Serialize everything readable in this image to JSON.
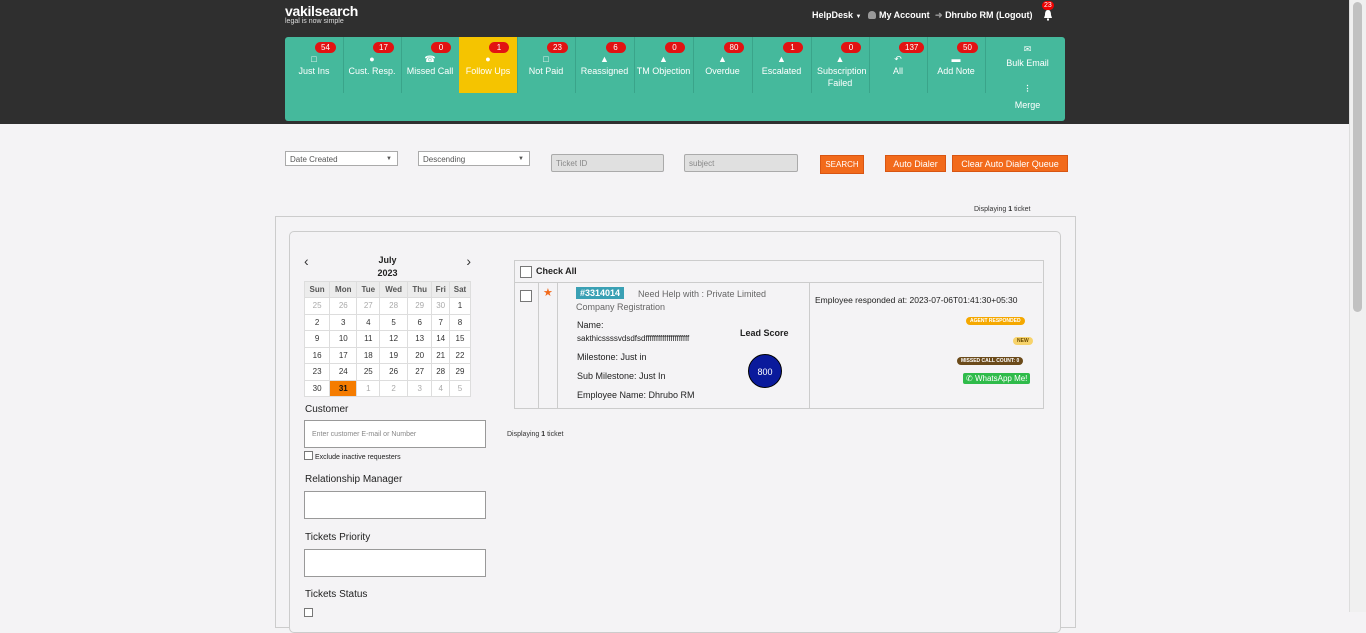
{
  "header": {
    "logo": "vakilsearch",
    "tagline": "legal is now simple",
    "helpdesk": "HelpDesk",
    "my_account": "My Account",
    "user": "Dhrubo RM (Logout)",
    "notif_count": "23"
  },
  "toolbar": {
    "items": [
      {
        "label": "Just Ins",
        "count": "54",
        "icon": "file-icon"
      },
      {
        "label": "Cust. Resp.",
        "count": "17",
        "icon": "user-icon"
      },
      {
        "label": "Missed Call",
        "count": "0",
        "icon": "phone-icon"
      },
      {
        "label": "Follow Ups",
        "count": "1",
        "icon": "user-icon",
        "active": true
      },
      {
        "label": "Not Paid",
        "count": "23",
        "icon": "file-icon"
      },
      {
        "label": "Reassigned",
        "count": "6",
        "icon": "bell-icon"
      },
      {
        "label": "TM Objection",
        "count": "0",
        "icon": "bell-icon"
      },
      {
        "label": "Overdue",
        "count": "80",
        "icon": "bell-icon"
      },
      {
        "label": "Escalated",
        "count": "1",
        "icon": "bell-icon"
      },
      {
        "label": "Subscription Failed",
        "count": "0",
        "icon": "bell-icon"
      },
      {
        "label": "All",
        "count": "137",
        "icon": "reply-icon"
      },
      {
        "label": "Add Note",
        "count": "50",
        "icon": "comment-icon"
      }
    ],
    "bulk_email": "Bulk Email",
    "merge": "Merge"
  },
  "filters": {
    "sort_field": "Date Created",
    "sort_order": "Descending",
    "ticket_id_placeholder": "Ticket ID",
    "subject_placeholder": "subject",
    "search": "SEARCH",
    "auto_dialer": "Auto Dialer",
    "clear_queue": "Clear Auto Dialer Queue"
  },
  "displaying_top": {
    "prefix": "Displaying ",
    "count": "1",
    "suffix": " ticket"
  },
  "calendar": {
    "month": "July",
    "year": "2023",
    "days": [
      "Sun",
      "Mon",
      "Tue",
      "Wed",
      "Thu",
      "Fri",
      "Sat"
    ],
    "weeks": [
      [
        "25",
        "26",
        "27",
        "28",
        "29",
        "30",
        "1"
      ],
      [
        "2",
        "3",
        "4",
        "5",
        "6",
        "7",
        "8"
      ],
      [
        "9",
        "10",
        "11",
        "12",
        "13",
        "14",
        "15"
      ],
      [
        "16",
        "17",
        "18",
        "19",
        "20",
        "21",
        "22"
      ],
      [
        "23",
        "24",
        "25",
        "26",
        "27",
        "28",
        "29"
      ],
      [
        "30",
        "31",
        "1",
        "2",
        "3",
        "4",
        "5"
      ]
    ]
  },
  "sidebar": {
    "customer_label": "Customer",
    "customer_placeholder": "Enter customer E-mail or Number",
    "exclude_inactive": "Exclude inactive requesters",
    "rm_label": "Relationship Manager",
    "priority_label": "Tickets Priority",
    "status_label": "Tickets Status"
  },
  "ticket_list": {
    "check_all": "Check All",
    "ticket": {
      "id": "#3314014",
      "subject_line1": "Need Help with : Private Limited",
      "subject_line2": "Company Registration",
      "name_label": "Name:",
      "name_value": "sakthicssssvdsdfsdfffffffffffffffffffff",
      "milestone": "Milestone: Just in",
      "sub_milestone": "Sub Milestone: Just In",
      "employee": "Employee Name: Dhrubo RM",
      "lead_score_label": "Lead Score",
      "lead_score": "800",
      "responded": "Employee responded at: 2023-07-06T01:41:30+05:30",
      "badge_agent": "AGENT RESPONDED",
      "badge_new": "NEW",
      "badge_missed": "MISSED CALL COUNT: 0",
      "whatsapp": "WhatsApp Me!"
    },
    "displaying": {
      "prefix": "Displaying ",
      "count": "1",
      "suffix": " ticket"
    }
  },
  "colors": {
    "toolbar": "#45b99c",
    "active": "#f5c400",
    "badge": "#e21212",
    "accent_orange": "#f26a1b",
    "ticket_id": "#3aa0b4",
    "score": "#0a1a9c",
    "whatsapp": "#2fbb4a"
  }
}
